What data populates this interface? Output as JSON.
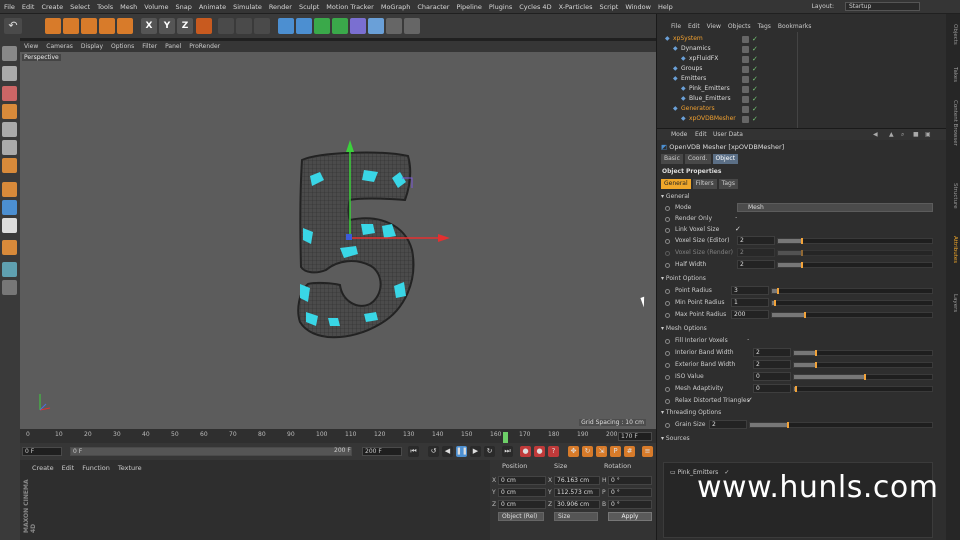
{
  "menubar": {
    "items": [
      "File",
      "Edit",
      "Create",
      "Select",
      "Tools",
      "Mesh",
      "Volume",
      "Snap",
      "Animate",
      "Simulate",
      "Render",
      "Sculpt",
      "Motion Tracker",
      "MoGraph",
      "Character",
      "Pipeline",
      "Plugins",
      "Cycles 4D",
      "X-Particles",
      "Script",
      "Window",
      "Help"
    ],
    "layout_label": "Layout:",
    "layout_value": "Startup"
  },
  "viewport": {
    "menu": [
      "View",
      "Cameras",
      "Display",
      "Options",
      "Filter",
      "Panel",
      "ProRender"
    ],
    "label": "Perspective",
    "grid_spacing": "Grid Spacing : 10 cm"
  },
  "timeline": {
    "ticks": [
      "0",
      "10",
      "20",
      "30",
      "40",
      "50",
      "60",
      "70",
      "80",
      "90",
      "100",
      "110",
      "120",
      "130",
      "140",
      "150",
      "160",
      "170",
      "180",
      "190",
      "200"
    ],
    "current_frame": 165,
    "end_frame_label": "170 F"
  },
  "playbar": {
    "start": "0 F",
    "current": "0 F",
    "end": "200 F",
    "end2": "200 F"
  },
  "material_manager": {
    "menu": [
      "Create",
      "Edit",
      "Function",
      "Texture"
    ],
    "brand": "MAXON CINEMA 4D"
  },
  "coordinates": {
    "headers": [
      "Position",
      "Size",
      "Rotation"
    ],
    "rows": [
      {
        "axis": "X",
        "pos": "0 cm",
        "size": "76.163 cm",
        "rlabel": "H",
        "rot": "0 °"
      },
      {
        "axis": "Y",
        "pos": "0 cm",
        "size": "112.573 cm",
        "rlabel": "P",
        "rot": "0 °"
      },
      {
        "axis": "Z",
        "pos": "0 cm",
        "size": "30.906 cm",
        "rlabel": "B",
        "rot": "0 °"
      }
    ],
    "mode": "Object (Rel)",
    "size_mode": "Size",
    "apply": "Apply"
  },
  "object_manager": {
    "menu": [
      "File",
      "Edit",
      "View",
      "Objects",
      "Tags",
      "Bookmarks"
    ],
    "objects": [
      {
        "name": "xpSystem",
        "color": "#f0a030",
        "indent": 0
      },
      {
        "name": "Dynamics",
        "color": "#ddd",
        "indent": 1
      },
      {
        "name": "xpFluidFX",
        "color": "#ddd",
        "indent": 2
      },
      {
        "name": "Groups",
        "color": "#ddd",
        "indent": 1
      },
      {
        "name": "Emitters",
        "color": "#ddd",
        "indent": 1
      },
      {
        "name": "Pink_Emitters",
        "color": "#ddd",
        "indent": 2
      },
      {
        "name": "Blue_Emitters",
        "color": "#ddd",
        "indent": 2
      },
      {
        "name": "Generators",
        "color": "#f0a030",
        "indent": 1
      },
      {
        "name": "xpOVDBMesher",
        "color": "#f0a030",
        "indent": 2
      }
    ]
  },
  "attributes": {
    "menu": [
      "Mode",
      "Edit",
      "User Data"
    ],
    "title": "OpenVDB Mesher [xpOVDBMesher]",
    "tabs": [
      "Basic",
      "Coord.",
      "Object"
    ],
    "active_tab": "Object",
    "section": "Object Properties",
    "subtabs": [
      "General",
      "Filters",
      "Tags"
    ],
    "active_subtab": "General",
    "general_title": "General",
    "mode_label": "Mode",
    "mode_value": "Mesh",
    "render_only": "Render Only",
    "link_voxel": "Link Voxel Size",
    "voxel_editor": "Voxel Size (Editor)",
    "voxel_editor_v": "2",
    "voxel_render": "Voxel Size (Render)",
    "voxel_render_v": "2",
    "half_width": "Half Width",
    "half_width_v": "2",
    "point_options": "Point Options",
    "point_radius": "Point Radius",
    "point_radius_v": "3",
    "min_point": "Min Point Radius",
    "min_point_v": "1",
    "max_point": "Max Point Radius",
    "max_point_v": "200",
    "mesh_options": "Mesh Options",
    "fill_interior": "Fill Interior Voxels",
    "interior_band": "Interior Band Width",
    "interior_band_v": "2",
    "exterior_band": "Exterior Band Width",
    "exterior_band_v": "2",
    "iso_value": "ISO Value",
    "iso_value_v": "0",
    "mesh_adapt": "Mesh Adaptivity",
    "mesh_adapt_v": "0",
    "relax": "Relax Distorted Triangles",
    "threading": "Threading Options",
    "grain": "Grain Size",
    "grain_v": "2",
    "sources": "Sources",
    "source_item": "Pink_Emitters"
  },
  "side_tabs": [
    "Objects",
    "Takes",
    "Content Browser",
    "Structure",
    "Attributes",
    "Layers"
  ],
  "watermark": "www.hunls.com",
  "colors": {
    "accent_orange": "#f0a72a",
    "blue_tab": "#5b6f86",
    "mesh_cyan": "#39d6e6",
    "axis_green": "#3bd13b",
    "axis_red": "#e33030"
  }
}
